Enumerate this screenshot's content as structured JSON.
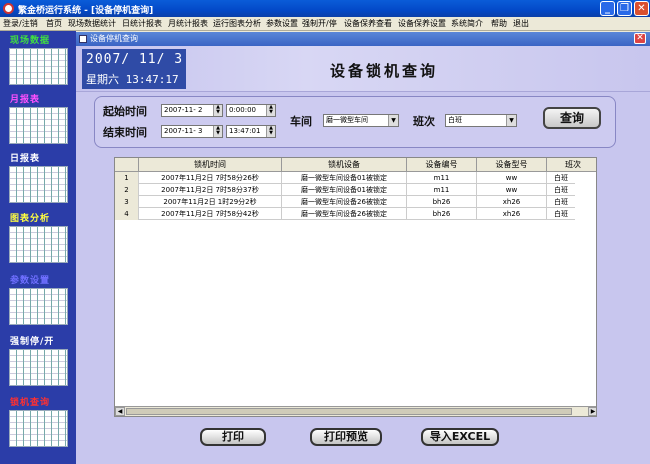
{
  "window": {
    "title": "繁金桥运行系统 - [设备停机查询]"
  },
  "menu": [
    "登录/注销",
    "首页",
    "现场数据统计",
    "日统计报表",
    "月统计报表",
    "运行图表分析",
    "参数设置",
    "强制开/停",
    "设备保养查看",
    "设备保养设置",
    "系统简介",
    "帮助",
    "退出"
  ],
  "sidebar": [
    {
      "label": "现场数据",
      "color": "#40e040"
    },
    {
      "label": "月报表",
      "color": "#ff50ff"
    },
    {
      "label": "日报表",
      "color": "#ffffff"
    },
    {
      "label": "图表分析",
      "color": "#ffff40"
    },
    {
      "label": "参数设置",
      "color": "#6f6fff"
    },
    {
      "label": "强制停/开",
      "color": "#ffffff"
    },
    {
      "label": "锁机查询",
      "color": "#ff3030"
    }
  ],
  "child": {
    "title": "设备停机查询"
  },
  "banner": {
    "date": "2007/ 11/  3",
    "time": "星期六 13:47:17",
    "heading": "设备锁机查询"
  },
  "filter": {
    "start_label": "起始时间",
    "end_label": "结束时间",
    "start_date": "2007-11- 2",
    "start_time": " 0:00:00",
    "end_date": "2007-11- 3",
    "end_time": "13:47:01",
    "workshop_label": "车间",
    "workshop_value": "磨一微型车间",
    "shift_label": "班次",
    "shift_value": "白班",
    "query_button": "查询"
  },
  "table": {
    "headers": [
      "",
      "锁机时间",
      "锁机设备",
      "设备编号",
      "设备型号",
      "班次"
    ],
    "rows": [
      [
        "1",
        "2007年11月2日  7时58分26秒",
        "磨一微型车间设备01被锁定",
        "m11",
        "ww",
        "白班"
      ],
      [
        "2",
        "2007年11月2日  7时58分37秒",
        "磨一微型车间设备01被锁定",
        "m11",
        "ww",
        "白班"
      ],
      [
        "3",
        "2007年11月2日  1时29分2秒",
        "磨一微型车间设备26被锁定",
        "bh26",
        "xh26",
        "白班"
      ],
      [
        "4",
        "2007年11月2日  7时58分42秒",
        "磨一微型车间设备26被锁定",
        "bh26",
        "xh26",
        "白班"
      ]
    ]
  },
  "actions": {
    "print": "打印",
    "preview": "打印预览",
    "export": "导入EXCEL"
  }
}
